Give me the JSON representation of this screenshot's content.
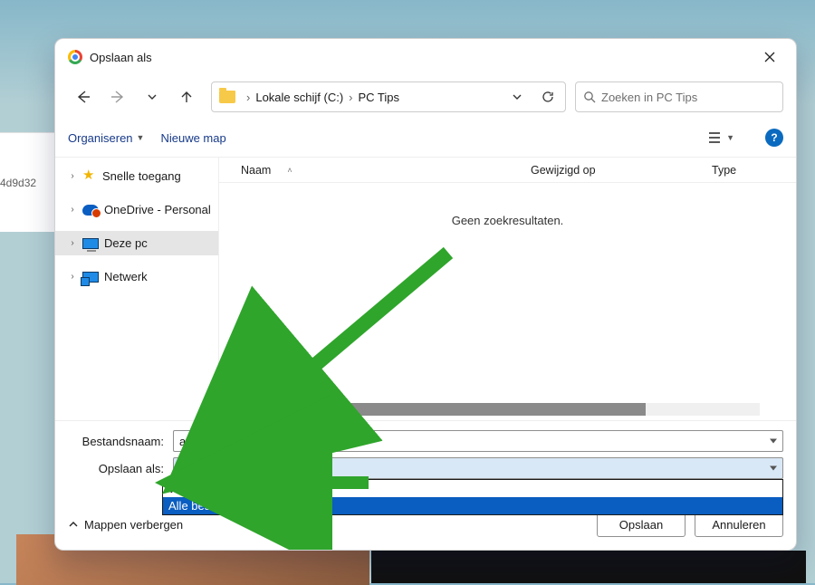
{
  "title": "Opslaan als",
  "nav": {
    "breadcrumb": {
      "drive": "Lokale schijf (C:)",
      "folder": "PC Tips"
    },
    "search_placeholder": "Zoeken in PC Tips"
  },
  "toolbar": {
    "organize": "Organiseren",
    "new_folder": "Nieuwe map",
    "help": "?"
  },
  "tree": [
    {
      "icon": "star",
      "label": "Snelle toegang",
      "expandable": true
    },
    {
      "icon": "cloud",
      "label": "OneDrive - Personal",
      "expandable": true
    },
    {
      "icon": "pc",
      "label": "Deze pc",
      "expandable": true,
      "selected": true
    },
    {
      "icon": "net",
      "label": "Netwerk",
      "expandable": true
    }
  ],
  "columns": {
    "name": "Naam",
    "modified": "Gewijzigd op",
    "type": "Type"
  },
  "empty": "Geen zoekresultaten.",
  "fields": {
    "filename_label": "Bestandsnaam:",
    "filename_value": "afbeelding.jpg",
    "save_as_label": "Opslaan als:",
    "save_as_selected": "Alle bestanden (*.*)",
    "options": [
      "WEBP-bestand (*.webp)",
      "Alle bestanden (*.*)"
    ]
  },
  "footer": {
    "hide_folders": "Mappen verbergen",
    "save": "Opslaan",
    "cancel": "Annuleren"
  },
  "bg": {
    "partial_text": "4d9d32"
  }
}
